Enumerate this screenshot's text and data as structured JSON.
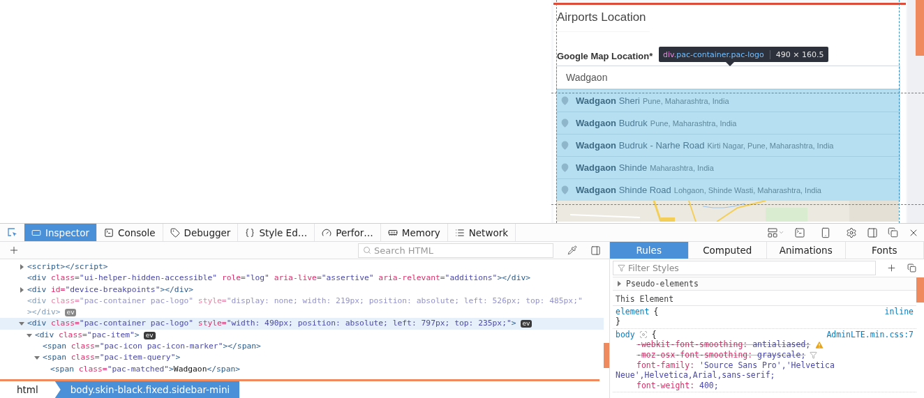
{
  "page": {
    "card_title": "Airports Location",
    "field_label": "Google Map Location*",
    "field_value": "Wadgaon",
    "suggestions": [
      {
        "matched": "Wadgaon",
        "rest": "Sheri",
        "secondary": "Pune, Maharashtra, India"
      },
      {
        "matched": "Wadgaon",
        "rest": "Budruk",
        "secondary": "Pune, Maharashtra, India"
      },
      {
        "matched": "Wadgaon",
        "rest": "Budruk - Narhe Road",
        "secondary": "Kirti Nagar, Pune, Maharashtra, India"
      },
      {
        "matched": "Wadgaon",
        "rest": "Shinde",
        "secondary": "Maharashtra, India"
      },
      {
        "matched": "Wadgaon",
        "rest": "Shinde Road",
        "secondary": "Lohgaon, Shinde Wasti, Maharashtra, India"
      }
    ],
    "tooltip": {
      "tag": "div",
      "classes": ".pac-container.pac-logo",
      "size": "490 × 160.5"
    }
  },
  "devtools": {
    "tabs": [
      {
        "label": "Inspector",
        "selected": true
      },
      {
        "label": "Console",
        "selected": false
      },
      {
        "label": "Debugger",
        "selected": false
      },
      {
        "label": "Style Ed…",
        "selected": false
      },
      {
        "label": "Perfor…",
        "selected": false
      },
      {
        "label": "Memory",
        "selected": false
      },
      {
        "label": "Network",
        "selected": false
      }
    ],
    "search": {
      "placeholder": "Search HTML"
    },
    "markup": [
      {
        "selected": false,
        "hidden": false,
        "expanded": false,
        "tokens": [
          {
            "kind": "tag",
            "text": "<script></script>"
          }
        ]
      },
      {
        "selected": false,
        "hidden": false,
        "tokens": [
          {
            "kind": "tag",
            "text": "<div"
          },
          {
            "kind": "attr",
            "text": " class="
          },
          {
            "kind": "value",
            "text": "\"ui-helper-hidden-accessible\""
          },
          {
            "kind": "attr",
            "text": " role="
          },
          {
            "kind": "value",
            "text": "\"log\""
          },
          {
            "kind": "attr",
            "text": " aria-live="
          },
          {
            "kind": "value",
            "text": "\"assertive\""
          },
          {
            "kind": "attr",
            "text": " aria-relevant="
          },
          {
            "kind": "value",
            "text": "\"additions\""
          },
          {
            "kind": "tag",
            "text": "></div>"
          }
        ]
      },
      {
        "selected": false,
        "hidden": false,
        "expanded": false,
        "tokens": [
          {
            "kind": "tag",
            "text": "<div"
          },
          {
            "kind": "attr",
            "text": " id="
          },
          {
            "kind": "value",
            "text": "\"device-breakpoints\""
          },
          {
            "kind": "tag",
            "text": "></div>"
          }
        ]
      },
      {
        "selected": false,
        "hidden": true,
        "badge": "ev",
        "tokens": [
          {
            "kind": "tag",
            "text": "<div"
          },
          {
            "kind": "attr",
            "text": " class="
          },
          {
            "kind": "value",
            "text": "\"pac-container pac-logo\""
          },
          {
            "kind": "attr",
            "text": " style="
          },
          {
            "kind": "value",
            "text": "\"display: none; width: 219px; position: absolute; left: 526px; top: 485px;\""
          },
          {
            "kind": "tag",
            "text": "></div>"
          }
        ]
      },
      {
        "selected": true,
        "hidden": false,
        "expanded": true,
        "badge": "ev",
        "tokens": [
          {
            "kind": "tag",
            "text": "<div"
          },
          {
            "kind": "attr",
            "text": " class="
          },
          {
            "kind": "value",
            "text": "\"pac-container pac-logo\""
          },
          {
            "kind": "attr",
            "text": " style="
          },
          {
            "kind": "value",
            "text": "\"width: 490px; position: absolute; left: 797px; top: 235px;\""
          },
          {
            "kind": "tag",
            "text": ">"
          }
        ],
        "children": [
          {
            "selected": false,
            "hidden": false,
            "expanded": true,
            "badge": "ev",
            "tokens": [
              {
                "kind": "tag",
                "text": "<div"
              },
              {
                "kind": "attr",
                "text": " class="
              },
              {
                "kind": "value",
                "text": "\"pac-item\""
              },
              {
                "kind": "tag",
                "text": ">"
              }
            ],
            "children": [
              {
                "selected": false,
                "hidden": false,
                "tokens": [
                  {
                    "kind": "tag",
                    "text": "<span"
                  },
                  {
                    "kind": "attr",
                    "text": " class="
                  },
                  {
                    "kind": "value",
                    "text": "\"pac-icon pac-icon-marker\""
                  },
                  {
                    "kind": "tag",
                    "text": "></span>"
                  }
                ]
              },
              {
                "selected": false,
                "hidden": false,
                "expanded": true,
                "tokens": [
                  {
                    "kind": "tag",
                    "text": "<span"
                  },
                  {
                    "kind": "attr",
                    "text": " class="
                  },
                  {
                    "kind": "value",
                    "text": "\"pac-item-query\""
                  },
                  {
                    "kind": "tag",
                    "text": ">"
                  }
                ],
                "children": [
                  {
                    "selected": false,
                    "hidden": false,
                    "tokens": [
                      {
                        "kind": "tag",
                        "text": "<span"
                      },
                      {
                        "kind": "attr",
                        "text": " class="
                      },
                      {
                        "kind": "value",
                        "text": "\"pac-matched\""
                      },
                      {
                        "kind": "tag",
                        "text": ">"
                      },
                      {
                        "kind": "text",
                        "text": "Wadgaon"
                      },
                      {
                        "kind": "tag",
                        "text": "</span>"
                      }
                    ]
                  }
                ]
              }
            ]
          }
        ]
      }
    ],
    "breadcrumbs": [
      {
        "label": "html",
        "selected": false
      },
      {
        "label": "body.skin-black.fixed.sidebar-mini",
        "selected": true
      }
    ],
    "sidebar_tabs": [
      {
        "label": "Rules",
        "selected": true
      },
      {
        "label": "Computed",
        "selected": false
      },
      {
        "label": "Animations",
        "selected": false
      },
      {
        "label": "Fonts",
        "selected": false
      }
    ],
    "filter": {
      "placeholder": "Filter Styles"
    },
    "pseudo_elements": {
      "label": "Pseudo-elements",
      "expanded": false
    },
    "this_element": "This Element",
    "rules": [
      {
        "selector": "element",
        "open": "{",
        "close": "}",
        "source": "inline"
      },
      {
        "selector": "body",
        "open": "{",
        "source": "AdminLTE.min.css:7",
        "declarations": [
          {
            "name": "-webkit-font-smoothing:",
            "value": " antialiased;",
            "overridden": true,
            "warning": true
          },
          {
            "name": "-moz-osx-font-smoothing:",
            "value": " grayscale;",
            "overridden": true,
            "warning": false
          },
          {
            "name": "font-family:",
            "value": " 'Source Sans Pro','Helvetica Neue',Helvetica,Arial,sans-serif;",
            "overridden": false,
            "warning": false
          },
          {
            "name": "font-weight:",
            "value": " 400;",
            "overridden": false,
            "warning": false
          }
        ]
      }
    ]
  }
}
